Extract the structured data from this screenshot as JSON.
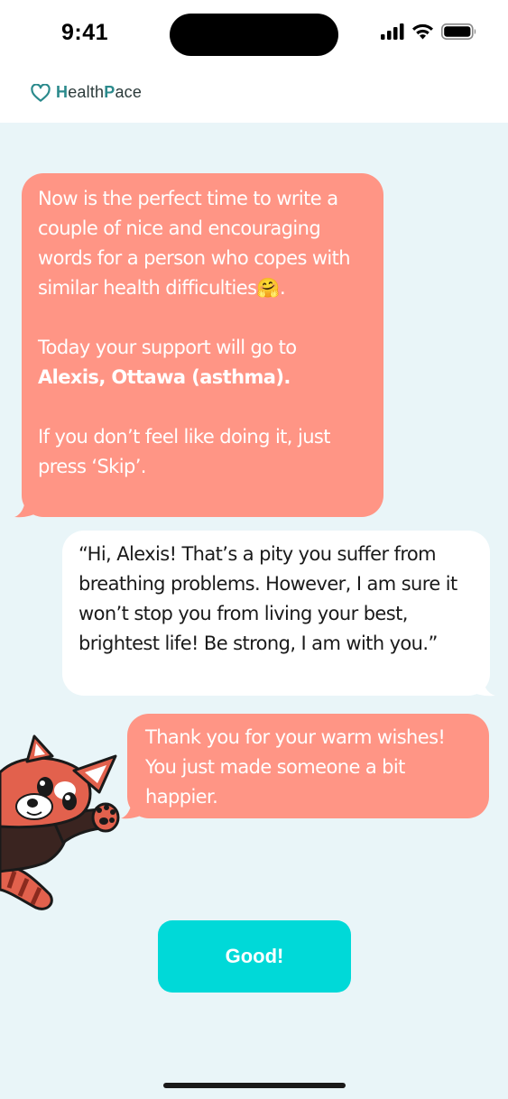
{
  "status": {
    "time": "9:41"
  },
  "app": {
    "brand_first": "H",
    "brand_mid": "ealth",
    "brand_second": "P",
    "brand_end": "ace"
  },
  "messages": {
    "bot_intro": {
      "p1": "Now is the perfect time to write a couple of nice and encouraging words for a person who copes with similar health difficulties🤗.",
      "p2": "Today your support will go to",
      "p2_bold": "Alexis, Ottawa (asthma).",
      "p3": "If you don’t feel like doing it, just press ‘Skip’."
    },
    "user_reply": "“Hi, Alexis! That’s a pity you suffer from breathing problems. However, I am sure it won’t stop you from living your best, brightest life!   Be strong, I am with you.”",
    "bot_thanks": "Thank you for your warm wishes! You just made someone a bit happier."
  },
  "actions": {
    "good_label": "Good!"
  },
  "icons": {
    "logo": "heart-outline-icon",
    "signal": "cellular-signal-icon",
    "wifi": "wifi-icon",
    "battery": "battery-icon",
    "mascot": "red-panda-mascot"
  },
  "colors": {
    "bot_bubble": "#ff9585",
    "user_bubble": "#ffffff",
    "accent": "#00d9d8",
    "background": "#e9f5f8",
    "brand": "#2b8a8c"
  }
}
